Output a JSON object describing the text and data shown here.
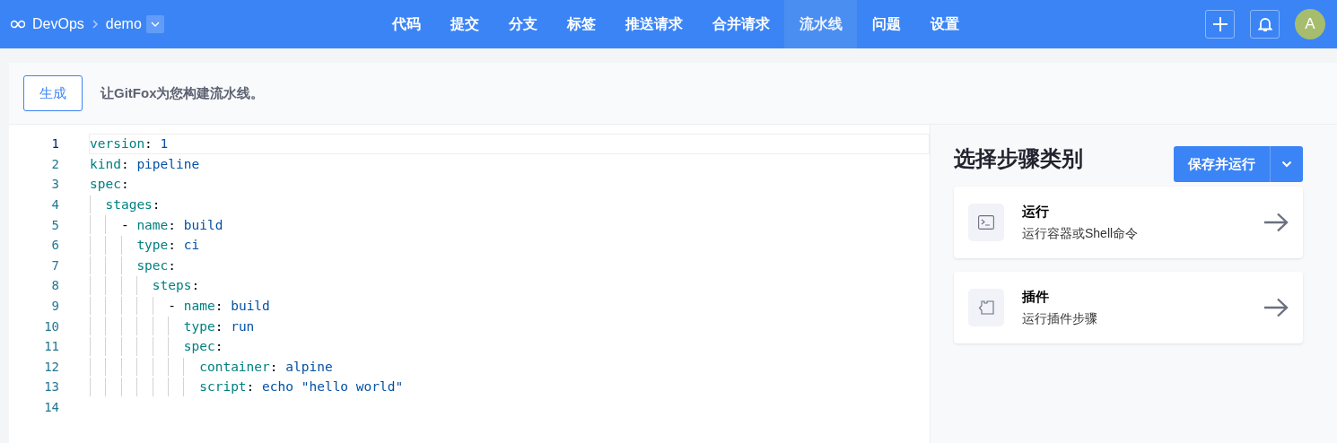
{
  "breadcrumb": {
    "org": "DevOps",
    "repo": "demo"
  },
  "nav": [
    {
      "label": "代码",
      "selected": false
    },
    {
      "label": "提交",
      "selected": false
    },
    {
      "label": "分支",
      "selected": false
    },
    {
      "label": "标签",
      "selected": false
    },
    {
      "label": "推送请求",
      "selected": false
    },
    {
      "label": "合并请求",
      "selected": false
    },
    {
      "label": "流水线",
      "selected": true
    },
    {
      "label": "问题",
      "selected": false
    },
    {
      "label": "设置",
      "selected": false
    }
  ],
  "user": {
    "avatar": "A"
  },
  "toolbar": {
    "button": "生成",
    "hint": "让GitFox为您构建流水线。"
  },
  "editor": {
    "lines": [
      {
        "number": "1",
        "text": "version: 1",
        "selected": true
      },
      {
        "number": "2",
        "text": "kind: pipeline",
        "selected": false
      },
      {
        "number": "3",
        "text": "spec:",
        "selected": false
      },
      {
        "number": "4",
        "text": "  stages:",
        "selected": false
      },
      {
        "number": "5",
        "text": "    - name: build",
        "selected": false
      },
      {
        "number": "6",
        "text": "      type: ci",
        "selected": false
      },
      {
        "number": "7",
        "text": "      spec:",
        "selected": false
      },
      {
        "number": "8",
        "text": "        steps:",
        "selected": false
      },
      {
        "number": "9",
        "text": "          - name: build",
        "selected": false
      },
      {
        "number": "10",
        "text": "            type: run",
        "selected": false
      },
      {
        "number": "11",
        "text": "            spec:",
        "selected": false
      },
      {
        "number": "12",
        "text": "              container: alpine",
        "selected": false
      },
      {
        "number": "13",
        "text": "              script: echo \"hello world\"",
        "selected": false
      },
      {
        "number": "14",
        "selected": false
      }
    ]
  },
  "panel": {
    "title": "选择步骤类别",
    "save_button": "保存并运行",
    "steps": [
      {
        "kind": "terminal",
        "title": "运行",
        "description": "运行容器或Shell命令"
      },
      {
        "kind": "plugin",
        "title": "插件",
        "description": "运行插件步骤"
      }
    ]
  }
}
